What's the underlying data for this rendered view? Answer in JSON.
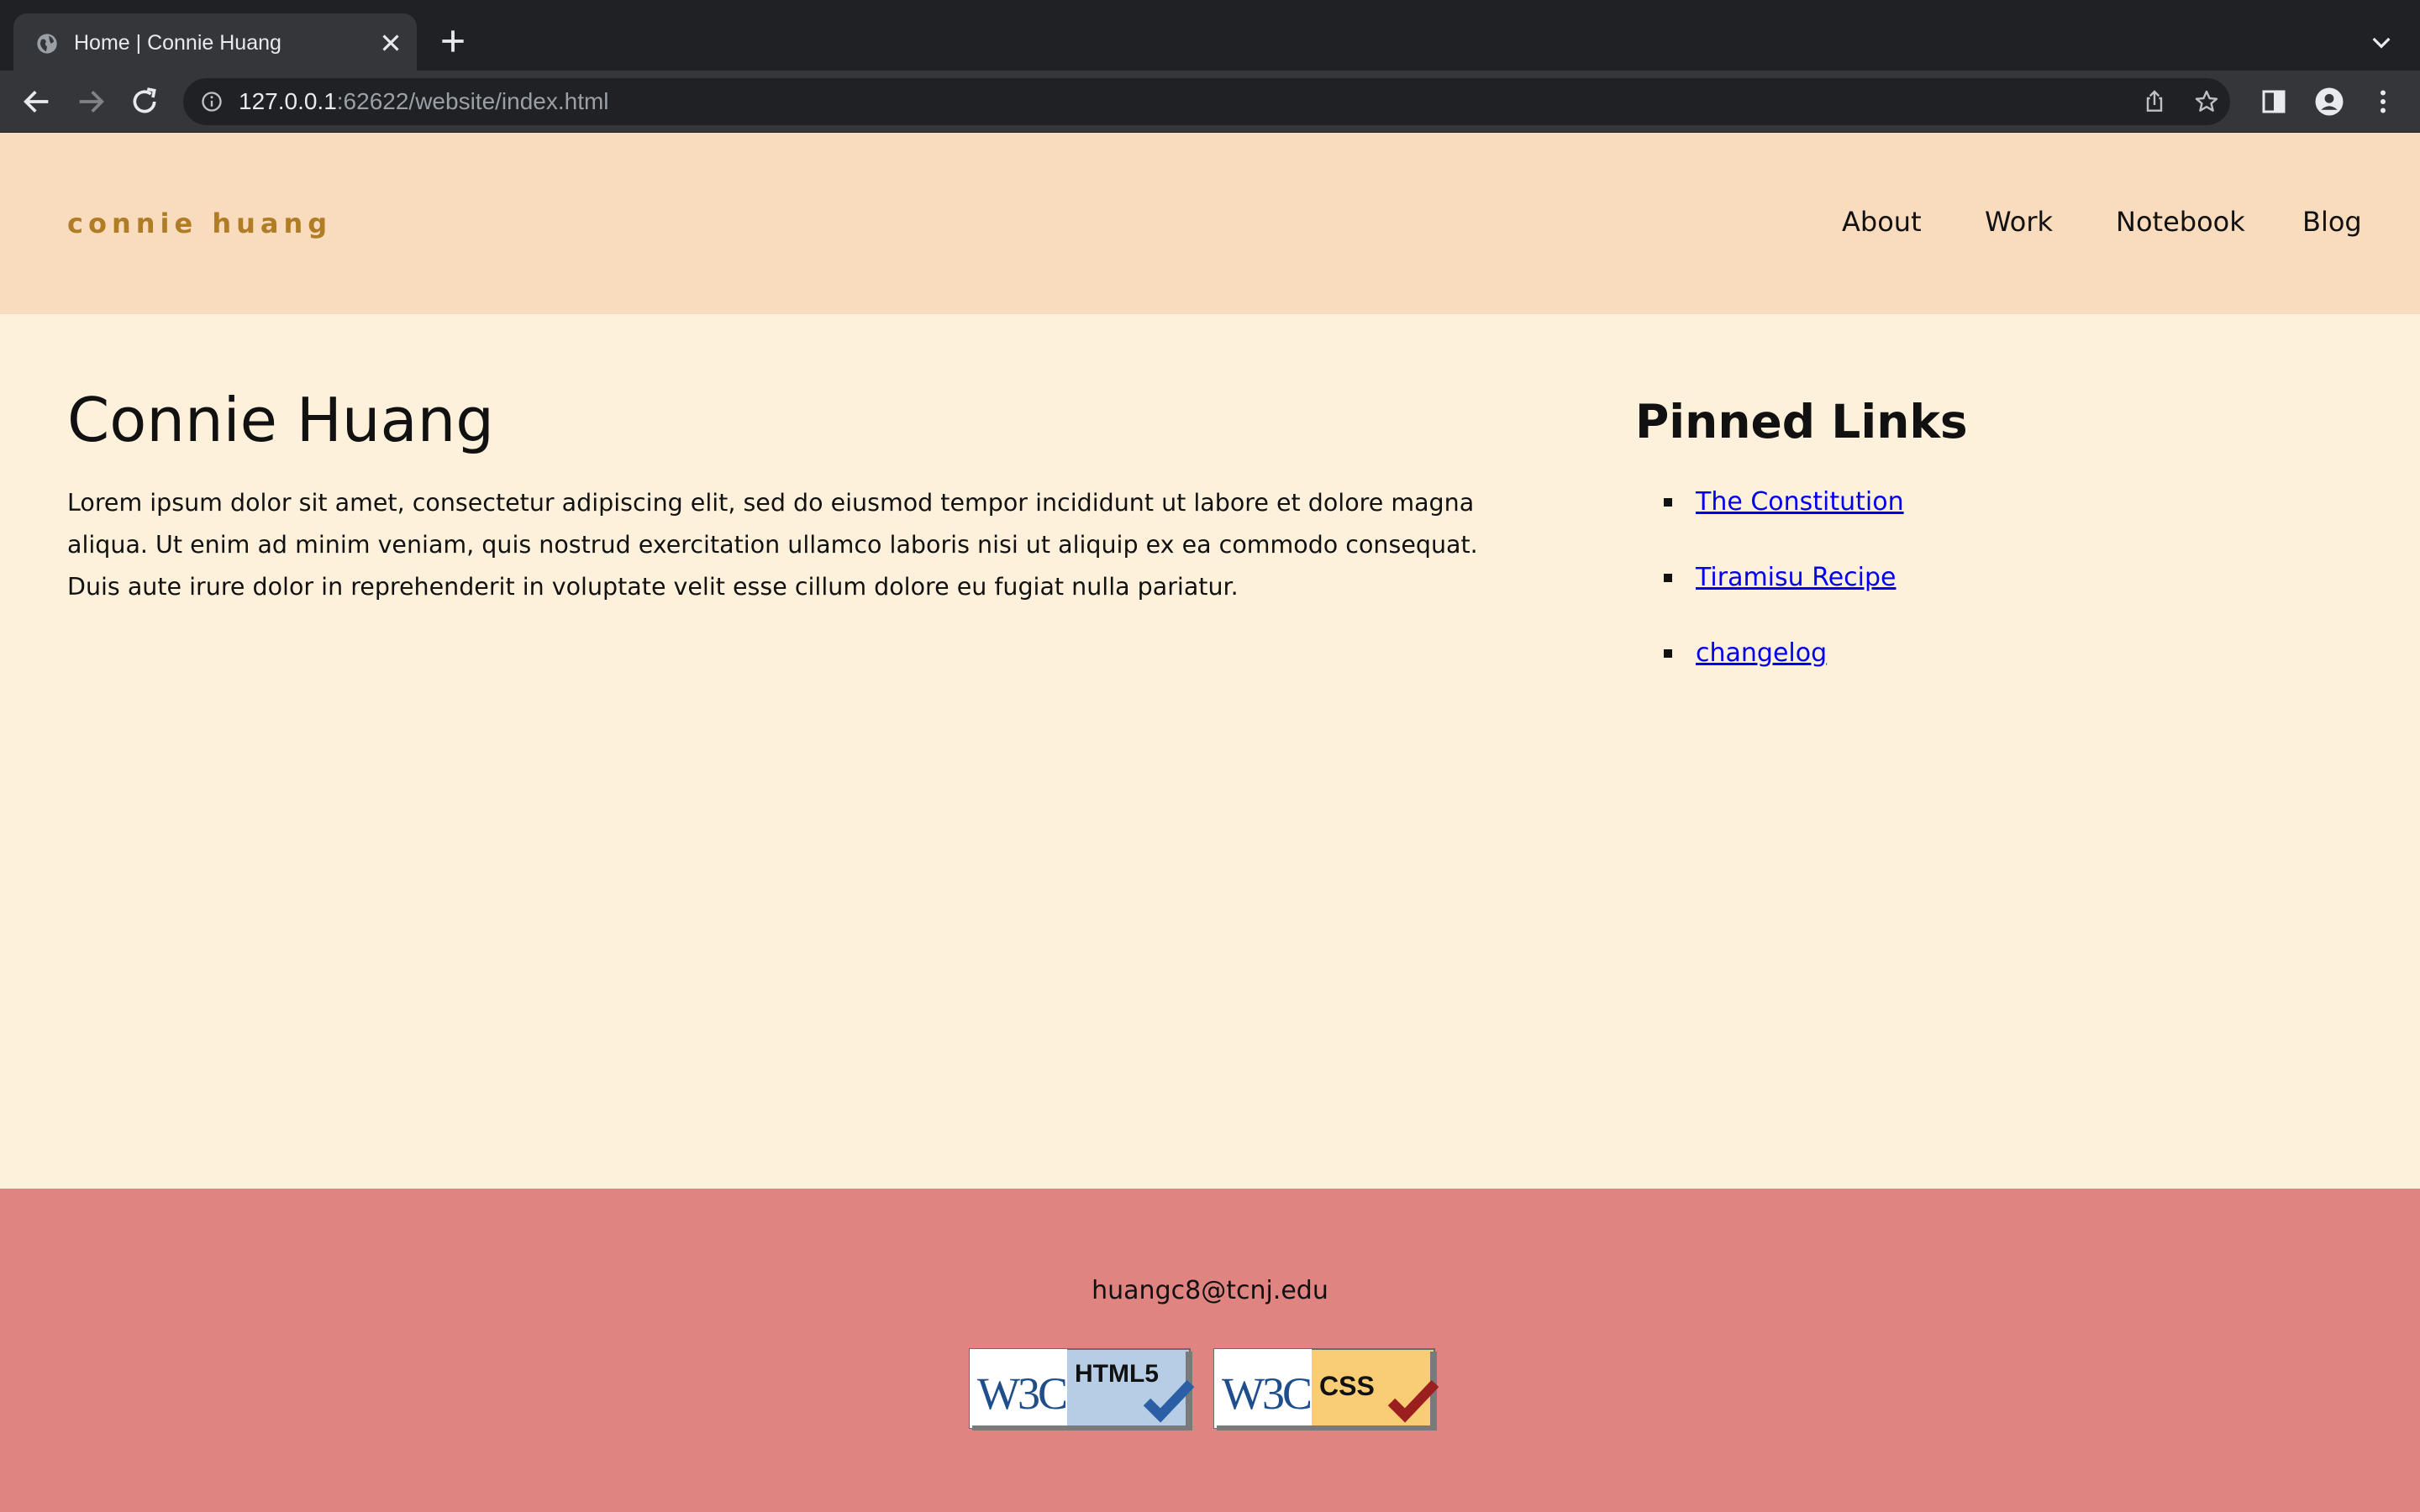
{
  "browser": {
    "tab_title": "Home | Connie Huang",
    "url_host": "127.0.0.1",
    "url_rest": ":62622/website/index.html"
  },
  "header": {
    "brand": "connie huang",
    "nav": [
      "About",
      "Work",
      "Notebook",
      "Blog"
    ]
  },
  "main": {
    "title": "Connie Huang",
    "intro": "Lorem ipsum dolor sit amet, consectetur adipiscing elit, sed do eiusmod tempor incididunt ut labore et dolore magna aliqua. Ut enim ad minim veniam, quis nostrud exercitation ullamco laboris nisi ut aliquip ex ea commodo consequat. Duis aute irure dolor in reprehenderit in voluptate velit esse cillum dolore eu fugiat nulla pariatur."
  },
  "pinned": {
    "title": "Pinned Links",
    "links": [
      "The Constitution",
      "Tiramisu Recipe",
      "changelog"
    ]
  },
  "footer": {
    "email": "huangc8@tcnj.edu",
    "badges": [
      {
        "logo": "W3C",
        "label": "HTML5",
        "icon": "w3c-html5-valid-badge"
      },
      {
        "logo": "W3C",
        "label": "CSS",
        "icon": "w3c-css-valid-badge"
      }
    ]
  },
  "colors": {
    "header_bg": "#f9dcbd",
    "page_bg": "#fdf1dc",
    "footer_bg": "#e08482",
    "brand": "#b07c26",
    "link": "#0000ee"
  }
}
